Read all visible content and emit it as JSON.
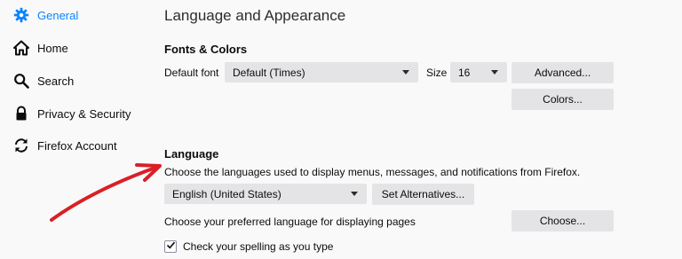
{
  "sidebar": {
    "items": [
      {
        "label": "General",
        "icon": "gear-icon",
        "active": true
      },
      {
        "label": "Home",
        "icon": "home-icon"
      },
      {
        "label": "Search",
        "icon": "search-icon"
      },
      {
        "label": "Privacy & Security",
        "icon": "lock-icon"
      },
      {
        "label": "Firefox Account",
        "icon": "sync-icon"
      }
    ]
  },
  "main": {
    "title": "Language and Appearance",
    "fonts": {
      "heading": "Fonts & Colors",
      "default_font_label": "Default font",
      "default_font_value": "Default (Times)",
      "size_label": "Size",
      "size_value": "16",
      "advanced_button": "Advanced...",
      "colors_button": "Colors..."
    },
    "language": {
      "heading": "Language",
      "description": "Choose the languages used to display menus, messages, and notifications from Firefox.",
      "ui_language_value": "English (United States)",
      "set_alternatives_button": "Set Alternatives...",
      "page_language_label": "Choose your preferred language for displaying pages",
      "choose_button": "Choose...",
      "spellcheck_label": "Check your spelling as you type",
      "spellcheck_checked": true
    }
  },
  "colors": {
    "accent": "#0a84ff",
    "annotation_arrow": "#d92027"
  }
}
